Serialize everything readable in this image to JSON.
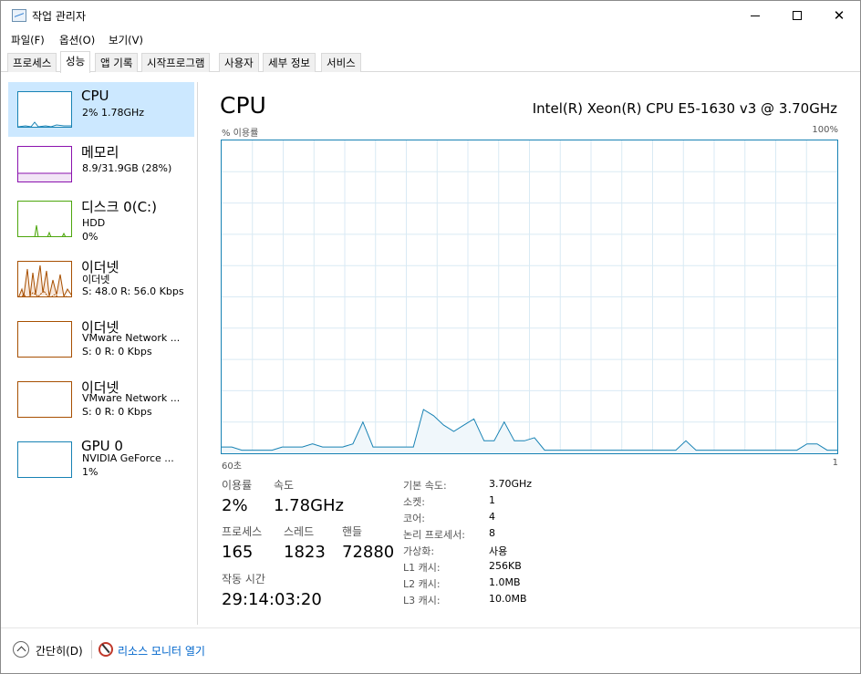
{
  "window": {
    "title": "작업 관리자",
    "min_glyph": "",
    "close_glyph": "✕"
  },
  "menu": [
    "파일(F)",
    "옵션(O)",
    "보기(V)"
  ],
  "tabs": [
    "프로세스",
    "성능",
    "앱 기록",
    "시작프로그램",
    "사용자",
    "세부 정보",
    "서비스"
  ],
  "active_tab": "성능",
  "sidebar": [
    {
      "title": "CPU",
      "lines": [
        "2% 1.78GHz"
      ],
      "color": "#1782b4",
      "selected": true
    },
    {
      "title": "메모리",
      "lines": [
        "8.9/31.9GB (28%)"
      ],
      "color": "#8b12ae"
    },
    {
      "title": "디스크 0(C:)",
      "lines": [
        "HDD",
        "0%"
      ],
      "color": "#4da60c"
    },
    {
      "title": "이더넷",
      "lines": [
        "이더넷",
        "S: 48.0  R: 56.0 Kbps"
      ],
      "color": "#a74f01"
    },
    {
      "title": "이더넷",
      "lines": [
        "VMware Network ...",
        "S: 0  R: 0 Kbps"
      ],
      "color": "#a74f01"
    },
    {
      "title": "이더넷",
      "lines": [
        "VMware Network ...",
        "S: 0  R: 0 Kbps"
      ],
      "color": "#a74f01"
    },
    {
      "title": "GPU 0",
      "lines": [
        "NVIDIA GeForce ...",
        "1%"
      ],
      "color": "#1782b4"
    }
  ],
  "main": {
    "title": "CPU",
    "model": "Intel(R) Xeon(R) CPU E5-1630 v3 @ 3.70GHz",
    "usage_label": "% 이용률",
    "max_label": "100%",
    "x_left": "60초",
    "x_right": "1"
  },
  "chart_data": {
    "type": "area",
    "ylim": [
      0,
      100
    ],
    "xlabel_left": "60초",
    "xlabel_right": "1",
    "color": "#1782b4",
    "values": [
      2,
      2,
      1,
      1,
      1,
      1,
      2,
      2,
      2,
      3,
      2,
      2,
      2,
      3,
      10,
      2,
      2,
      2,
      2,
      2,
      14,
      12,
      9,
      7,
      9,
      11,
      4,
      4,
      10,
      4,
      4,
      5,
      1,
      1,
      1,
      1,
      1,
      1,
      1,
      1,
      1,
      1,
      1,
      1,
      1,
      1,
      4,
      1,
      1,
      1,
      1,
      1,
      1,
      1,
      1,
      1,
      1,
      1,
      3,
      3,
      1,
      1
    ]
  },
  "stats": {
    "utilization_label": "이용률",
    "utilization": "2%",
    "speed_label": "속도",
    "speed": "1.78GHz",
    "processes_label": "프로세스",
    "processes": "165",
    "threads_label": "스레드",
    "threads": "1823",
    "handles_label": "핸들",
    "handles": "72880",
    "uptime_label": "작동 시간",
    "uptime": "29:14:03:20"
  },
  "info": [
    {
      "label": "기본 속도:",
      "value": "3.70GHz"
    },
    {
      "label": "소켓:",
      "value": "1"
    },
    {
      "label": "코어:",
      "value": "4"
    },
    {
      "label": "논리 프로세서:",
      "value": "8"
    },
    {
      "label": "가상화:",
      "value": "사용"
    },
    {
      "label": "L1 캐시:",
      "value": "256KB"
    },
    {
      "label": "L2 캐시:",
      "value": "1.0MB"
    },
    {
      "label": "L3 캐시:",
      "value": "10.0MB"
    }
  ],
  "footer": {
    "fewer": "간단히(D)",
    "resmon": "리소스 모니터 열기"
  }
}
